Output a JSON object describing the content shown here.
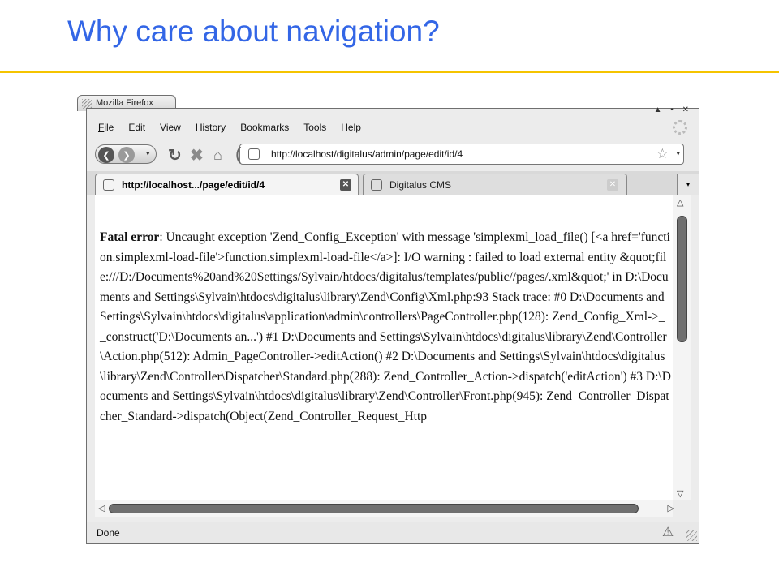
{
  "slide": {
    "title": "Why care about navigation?"
  },
  "window": {
    "title": "Mozilla Firefox",
    "controls": "▲ ▪ ✕"
  },
  "menu": {
    "items": [
      "File",
      "Edit",
      "View",
      "History",
      "Bookmarks",
      "Tools",
      "Help"
    ],
    "accel": [
      "F",
      "E",
      "V",
      "s",
      "B",
      "T",
      "H"
    ]
  },
  "nav": {
    "back_icon": "❮",
    "forward_icon": "❯",
    "dropdown_icon": "▾",
    "reload_icon": "↻",
    "stop_icon": "✖",
    "home_icon": "⌂",
    "url": "http://localhost/digitalus/admin/page/edit/id/4",
    "star_icon": "☆"
  },
  "tabs": [
    {
      "label": "http://localhost.../page/edit/id/4",
      "active": true
    },
    {
      "label": "Digitalus CMS",
      "active": false
    }
  ],
  "content": {
    "error_label": "Fatal error",
    "error_message": ": Uncaught exception 'Zend_Config_Exception' with message 'simplexml_load_file() [<a href='function.simplexml-load-file'>function.simplexml-load-file</a>]: I/O warning : failed to load external entity &quot;file:///D:/Documents%20and%20Settings/Sylvain/htdocs/digitalus/templates/public//pages/.xml&quot;' in D:\\Documents and Settings\\Sylvain\\htdocs\\digitalus\\library\\Zend\\Config\\Xml.php:93 Stack trace: #0 D:\\Documents and Settings\\Sylvain\\htdocs\\digitalus\\application\\admin\\controllers\\PageController.php(128): Zend_Config_Xml->__construct('D:\\Documents an...') #1 D:\\Documents and Settings\\Sylvain\\htdocs\\digitalus\\library\\Zend\\Controller\\Action.php(512): Admin_PageController->editAction() #2 D:\\Documents and Settings\\Sylvain\\htdocs\\digitalus\\library\\Zend\\Controller\\Dispatcher\\Standard.php(288): Zend_Controller_Action->dispatch('editAction') #3 D:\\Documents and Settings\\Sylvain\\htdocs\\digitalus\\library\\Zend\\Controller\\Front.php(945): Zend_Controller_Dispatcher_Standard->dispatch(Object(Zend_Controller_Request_Http"
  },
  "status": {
    "text": "Done",
    "warning_icon": "⚠"
  },
  "colors": {
    "title": "#3366e6",
    "rule": "#f5c400"
  }
}
